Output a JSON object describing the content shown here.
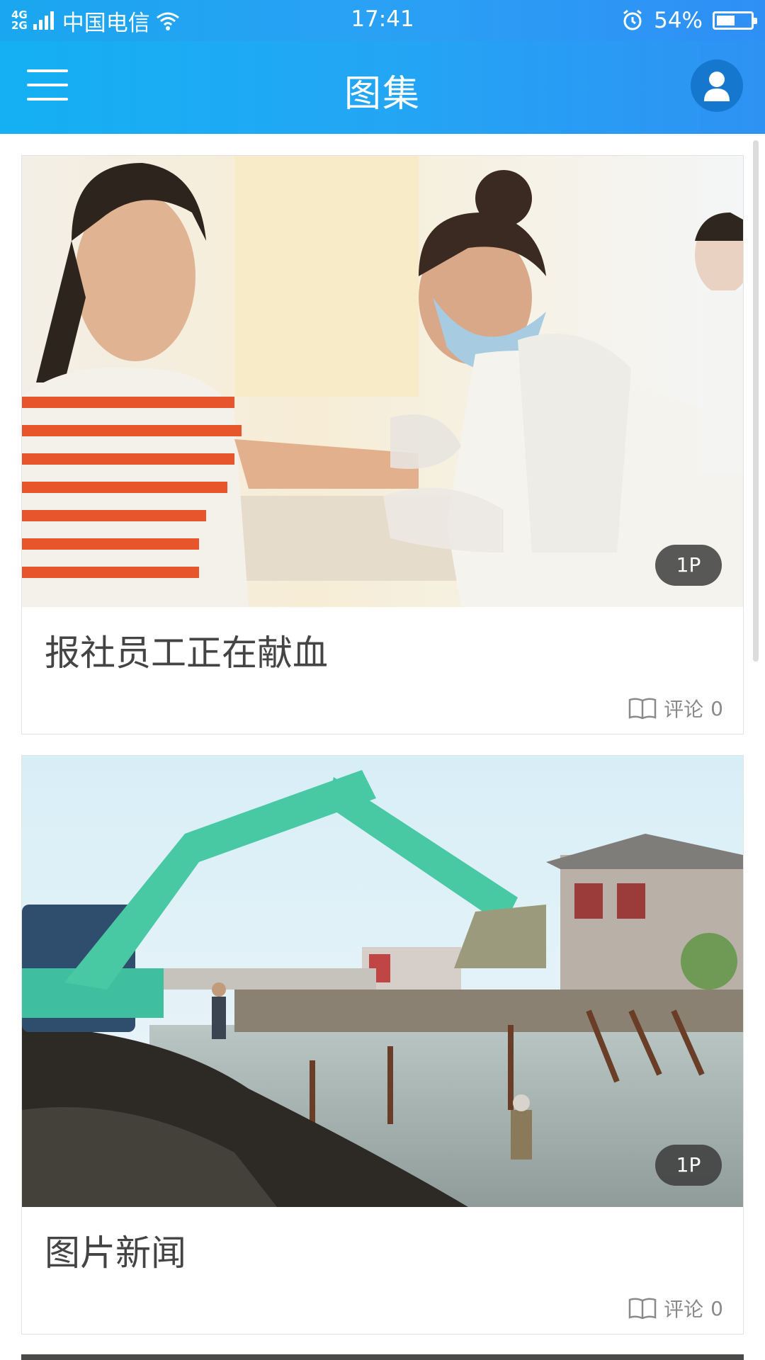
{
  "status_bar": {
    "network_top": "4G",
    "network_bottom": "2G",
    "carrier": "中国电信",
    "time": "17:41",
    "battery_percent_text": "54%",
    "battery_level": 0.54
  },
  "header": {
    "title": "图集"
  },
  "cards": [
    {
      "title": "报社员工正在献血",
      "badge": "1P",
      "comment_label": "评论",
      "comment_count": "0"
    },
    {
      "title": "图片新闻",
      "badge": "1P",
      "comment_label": "评论",
      "comment_count": "0"
    }
  ],
  "colors": {
    "header_blue": "#23a6f4",
    "avatar_bg": "#1677cf",
    "title_text": "#444444",
    "meta_text": "#8a8a8a",
    "badge_bg": "#3c3c3c"
  },
  "icons": [
    "wifi-icon",
    "alarm-icon",
    "battery-icon",
    "menu-icon",
    "user-icon",
    "book-icon"
  ]
}
